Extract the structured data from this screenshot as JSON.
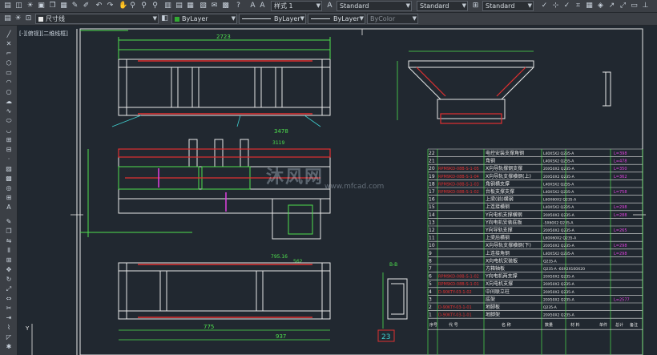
{
  "toolbar_top": {
    "layer_dropdown": "尺寸线",
    "color_dropdown": "ByLayer",
    "linetype_dropdown": "ByLayer",
    "lineweight_dropdown": "ByLayer",
    "plotstyle_dropdown": "ByColor",
    "style_dropdown": "样式 1",
    "textstyle_dropdown": "Standard",
    "dimstyle_dropdown": "Standard",
    "tablestyle_dropdown": "Standard"
  },
  "viewport": {
    "label": "[-][俯视][二维线框]"
  },
  "drawing": {
    "dims": {
      "top_overall": "2723",
      "mid_overall": "3478",
      "mid_sub1": "3119",
      "bottom_1": "775",
      "bottom_2": "937",
      "bottom_3": "795.16",
      "bottom_4": "562"
    },
    "side_view_label": "B-B",
    "section_label": "B-B",
    "balloon_number": "23",
    "table_header": [
      "序号",
      "代 号",
      "名 称",
      "数量",
      "材 料",
      "单件",
      "总计",
      "备注"
    ],
    "table_rows": [
      {
        "no": "22",
        "code": "",
        "name": "电控安装支撑角钢",
        "mat": "L40X5X2 Q235-A",
        "len": "L=398"
      },
      {
        "no": "21",
        "code": "",
        "name": "角钢",
        "mat": "L40X5X2 Q235-A",
        "len": "L=478"
      },
      {
        "no": "20",
        "code": "RPM9KD-08B-S-1-05",
        "name": "X向导轨撑钢支撑",
        "mat": "20X50X2 Q235-A",
        "len": "L=350"
      },
      {
        "no": "19",
        "code": "RPM9KD-08B-S-1-04",
        "name": "X向导轨支撑横钢(上)",
        "mat": "20X50X2 Q235-A",
        "len": "L=362"
      },
      {
        "no": "18",
        "code": "RPM9KD-08B-S-1-03",
        "name": "角钢横支撑",
        "mat": "L40X5X2 Q235-A",
        "len": ""
      },
      {
        "no": "17",
        "code": "RPM9KD-08B-S-1-02",
        "name": "台板支撑支撑",
        "mat": "L40X5X2 Q235-A",
        "len": "L=758"
      },
      {
        "no": "16",
        "code": "",
        "name": "上梁(前)横钢",
        "mat": "L60X60X2 Q235-A",
        "len": ""
      },
      {
        "no": "15",
        "code": "",
        "name": "上连接横钢",
        "mat": "L40X5X2 Q235-A",
        "len": "L=298"
      },
      {
        "no": "14",
        "code": "",
        "name": "Y向电机支撑横钢",
        "mat": "20X50X2 Q235-A",
        "len": "L=288"
      },
      {
        "no": "13",
        "code": "",
        "name": "Y向电机安装底板",
        "mat": "-5X60X2 Q235-A",
        "len": ""
      },
      {
        "no": "12",
        "code": "",
        "name": "Y向导轨支撑",
        "mat": "20X50X2 Q235-A",
        "len": "L=265"
      },
      {
        "no": "11",
        "code": "",
        "name": "上梁后横钢",
        "mat": "L60X60X2 Q235-A",
        "len": ""
      },
      {
        "no": "10",
        "code": "",
        "name": "X向导轨支撑横钢(下)",
        "mat": "20X50X2 Q235-A",
        "len": "L=298"
      },
      {
        "no": "9",
        "code": "",
        "name": "上连接角钢",
        "mat": "L40X5X2 Q235-A",
        "len": "L=298"
      },
      {
        "no": "8",
        "code": "",
        "name": "X向电机安装板",
        "mat": "Q235-A",
        "len": ""
      },
      {
        "no": "7",
        "code": "",
        "name": "方箱轴板",
        "mat": "Q235-A -60X2X100X20",
        "len": ""
      },
      {
        "no": "6",
        "code": "RPM9KD-08B-S-1-02",
        "name": "Y向电机两支撑",
        "mat": "20X50X2 Q235-A",
        "len": ""
      },
      {
        "no": "5",
        "code": "RPM9KD-08B-S-1-01",
        "name": "X向电机支撑",
        "mat": "20X50X2 Q235-A",
        "len": ""
      },
      {
        "no": "4",
        "code": "D-90KTY-03-1-02",
        "name": "中间联立柱",
        "mat": "20X50X2 Q235-A",
        "len": ""
      },
      {
        "no": "3",
        "code": "",
        "name": "底架",
        "mat": "20X50X2 Q235-A",
        "len": "L=2577"
      },
      {
        "no": "2",
        "code": "D-90KTY-03-1-01",
        "name": "地脚板",
        "mat": "Q235-A",
        "len": ""
      },
      {
        "no": "1",
        "code": "D-90KTY-03-1-01",
        "name": "地脚架",
        "mat": "20X50X2 Q235-A",
        "len": ""
      }
    ]
  },
  "watermark": {
    "text": "沐风网",
    "url": "www.mfcad.com"
  },
  "colors": {
    "background": "#212830",
    "frame": "#e8e8e8",
    "green": "#4ee04e",
    "red": "#e03030",
    "cyan": "#40d0d0",
    "yellow": "#e0e040",
    "magenta": "#e040e0"
  }
}
